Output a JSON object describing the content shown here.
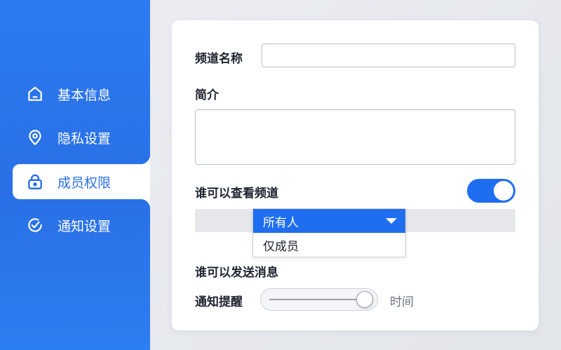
{
  "sidebar": {
    "items": [
      {
        "label": "基本信息",
        "icon": "home-icon"
      },
      {
        "label": "隐私设置",
        "icon": "location-pin-icon"
      },
      {
        "label": "成员权限",
        "icon": "lock-icon",
        "active": true
      },
      {
        "label": "通知设置",
        "icon": "check-circle-icon"
      }
    ]
  },
  "form": {
    "channel_name_label": "频道名称",
    "channel_name_value": "",
    "intro_label": "简介",
    "intro_value": "",
    "who_can_view_label": "谁可以查看频道",
    "who_can_view_toggle_on": true,
    "who_can_view_options": [
      "所有人",
      "仅成员"
    ],
    "who_can_view_selected": "所有人",
    "who_can_send_label": "谁可以发送消息",
    "notify_label": "通知提醒",
    "notify_slider_level": 0.88,
    "notify_slider_caption": "时间"
  },
  "colors": {
    "accent": "#1f6ef0",
    "sidebar_bg": "#2a6fe6"
  }
}
